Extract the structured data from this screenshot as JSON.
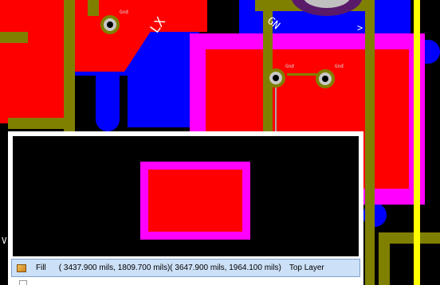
{
  "pcb": {
    "silkscreen": {
      "net_lx": "LX",
      "net_gnd": "GN",
      "marker_right": ">",
      "marker_left": "V"
    },
    "pad_labels": {
      "pad1": "Gnd",
      "pad2": "Gnd",
      "pad3": "Gnd"
    }
  },
  "preview": {
    "selected_item": {
      "type": "Fill",
      "coords": "( 3437.900 mils,  1809.700 mils)( 3647.900 mils,  1964.100 mils)",
      "layer": "Top Layer",
      "icon": "fill-icon"
    }
  },
  "colors": {
    "top_layer": "#ff0000",
    "bottom_layer": "#0000ff",
    "solder_mask": "#ff00ff",
    "silkscreen_track": "#808000",
    "keepout": "#ffff00",
    "selection_highlight": "#cce0f7"
  }
}
